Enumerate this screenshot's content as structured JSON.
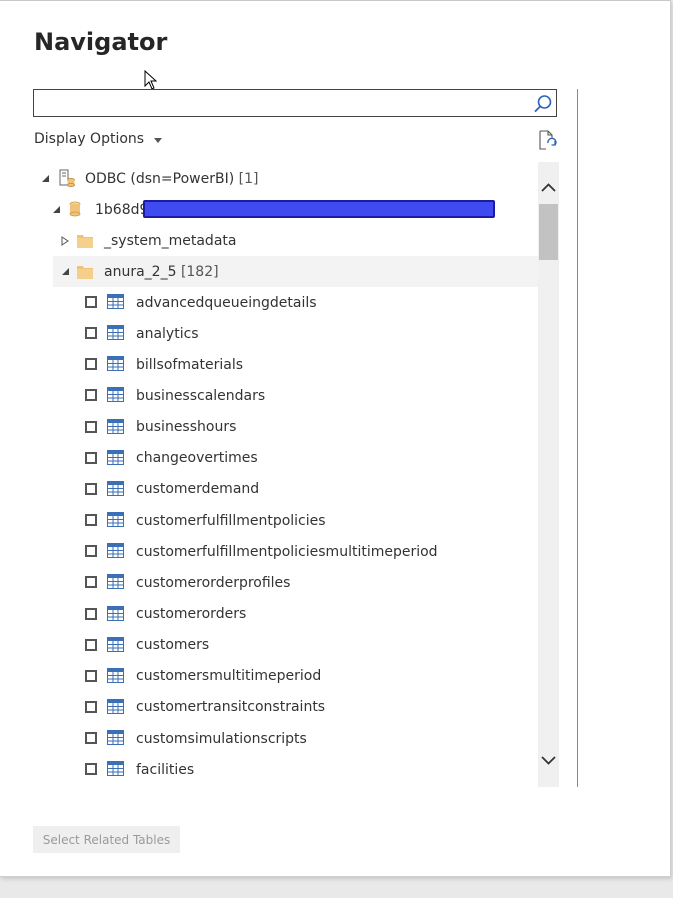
{
  "window": {
    "title": "Navigator"
  },
  "search": {
    "placeholder": "",
    "value": ""
  },
  "toolbar": {
    "display_options_label": "Display Options"
  },
  "tree": {
    "root": {
      "label": "ODBC (dsn=PowerBI)",
      "count": "[1]"
    },
    "database": {
      "label": "1b68d9"
    },
    "schemas": [
      {
        "label": "_system_metadata",
        "count": ""
      },
      {
        "label": "anura_2_5",
        "count": "[182]"
      }
    ],
    "tables": [
      "advancedqueueingdetails",
      "analytics",
      "billsofmaterials",
      "businesscalendars",
      "businesshours",
      "changeovertimes",
      "customerdemand",
      "customerfulfillmentpolicies",
      "customerfulfillmentpoliciesmultitimeperiod",
      "customerorderprofiles",
      "customerorders",
      "customers",
      "customersmultitimeperiod",
      "customertransitconstraints",
      "customsimulationscripts",
      "facilities"
    ]
  },
  "footer": {
    "select_related_label": "Select Related Tables"
  },
  "colors": {
    "redaction": "#3f4bf0",
    "folder": "#f0c27a",
    "table_icon": "#3b6fb6"
  }
}
